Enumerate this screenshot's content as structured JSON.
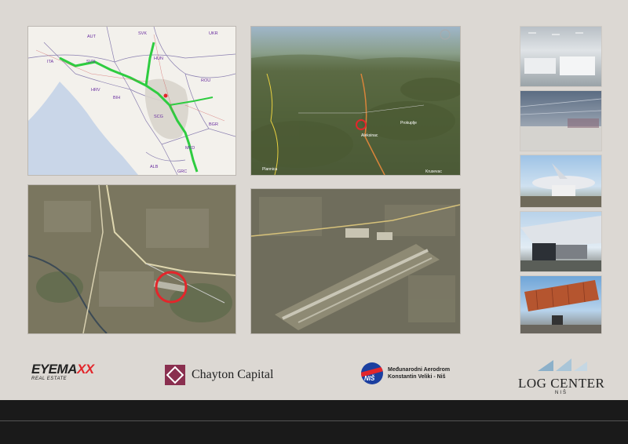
{
  "map": {
    "countries": [
      "SVK",
      "UKR",
      "AUT",
      "HUN",
      "ITA",
      "SVN",
      "ROU",
      "HRV",
      "BIH",
      "SCG",
      "BGR",
      "MKD",
      "ALB",
      "GRC"
    ]
  },
  "aerial_terrain": {
    "labels": [
      "Plannica",
      "Krusevac",
      "Aleksinac",
      "Prokuplje"
    ]
  },
  "logos": {
    "eyemaxx_main": "EYEMAXX",
    "eyemaxx_sub": "REAL ESTATE",
    "chayton": "Chayton Capital",
    "airport_line1": "Međunarodni Aerodrom",
    "airport_line2": "Konstantin Veliki - Niš",
    "logcenter_main": "LOG CENTER",
    "logcenter_sub": "NIŠ"
  },
  "colors": {
    "background": "#dcd8d3",
    "route": "#2ecc40",
    "marker": "#e3262b",
    "footer": "#1a1a1a"
  }
}
